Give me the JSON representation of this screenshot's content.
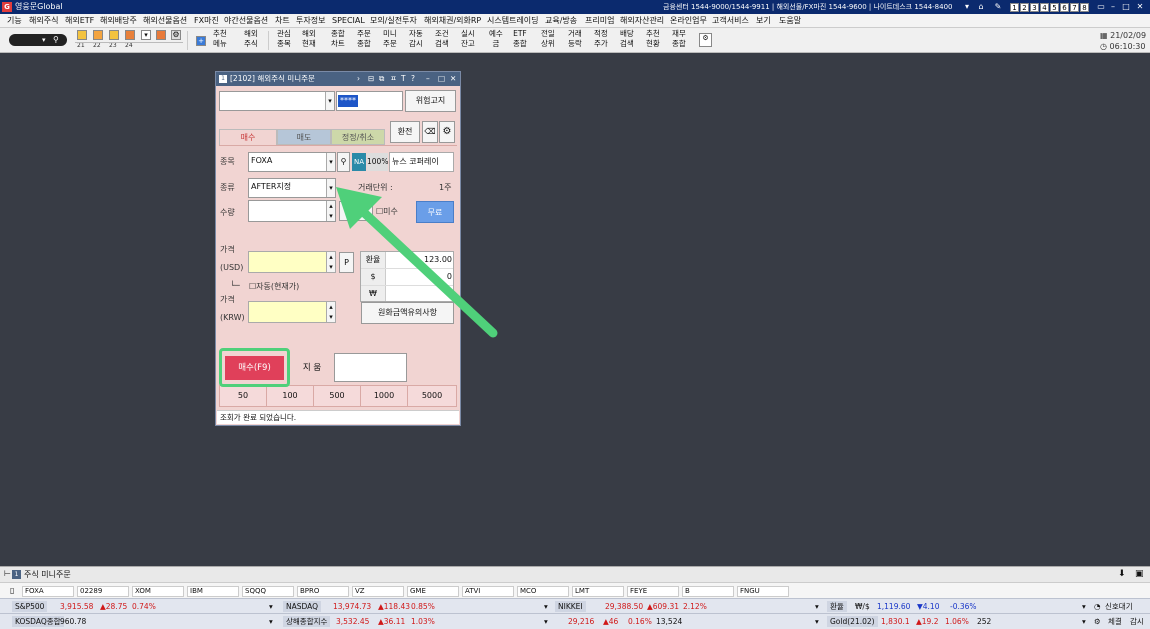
{
  "app": {
    "title": "영웅문Global",
    "info": "금융센터 1544-9000/1544-9911 | 해외선물/FX마진 1544-9600 | 나이트데스크 1544-8400",
    "screen_numbers": [
      "1",
      "2",
      "3",
      "4",
      "5",
      "6",
      "7",
      "8"
    ]
  },
  "menu": [
    "기능",
    "해외주식",
    "해외ETF",
    "해외배당주",
    "해외선물옵션",
    "FX마진",
    "야간선물옵션",
    "차트",
    "투자정보",
    "SPECIAL",
    "모의/실전투자",
    "해외채권/외화RP",
    "시스템트레이딩",
    "교육/방송",
    "프리미엄",
    "해외자산관리",
    "온라인업무",
    "고객서비스",
    "보기",
    "도움말"
  ],
  "toolbar": {
    "group_labels": [
      "21",
      "22",
      "23",
      "24"
    ],
    "buttons": [
      {
        "l1": "추천",
        "l2": "메뉴"
      },
      {
        "l1": "해외",
        "l2": "주식"
      },
      {
        "l1": "관심",
        "l2": "종목"
      },
      {
        "l1": "해외",
        "l2": "현재"
      },
      {
        "l1": "종합",
        "l2": "차트"
      },
      {
        "l1": "주문",
        "l2": "종합"
      },
      {
        "l1": "미니",
        "l2": "주문"
      },
      {
        "l1": "자동",
        "l2": "감시"
      },
      {
        "l1": "조건",
        "l2": "검색"
      },
      {
        "l1": "실시",
        "l2": "잔고"
      },
      {
        "l1": "예수",
        "l2": "금"
      },
      {
        "l1": "ETF",
        "l2": "종합"
      },
      {
        "l1": "전일",
        "l2": "상위"
      },
      {
        "l1": "거래",
        "l2": "등락"
      },
      {
        "l1": "적정",
        "l2": "주가"
      },
      {
        "l1": "배당",
        "l2": "검색"
      },
      {
        "l1": "추천",
        "l2": "현황"
      },
      {
        "l1": "재무",
        "l2": "종합"
      }
    ],
    "date": "21/02/09",
    "time": "06:10:30"
  },
  "dialog": {
    "title": "[2102] 해외주식 미니주문",
    "account_value": "",
    "password_mask": "****",
    "risk_button": "위험고지",
    "tabs": {
      "buy": "매수",
      "sell": "매도",
      "modify": "정정/취소"
    },
    "exchange_button": "환전",
    "labels": {
      "symbol": "종목",
      "type": "종류",
      "qty": "수량",
      "price": "가격",
      "usd": "(USD)",
      "krw": "(KRW)",
      "trade_unit": "거래단위 :",
      "trade_unit_value": "1주",
      "auto": "자동(현재가)",
      "misu": "미수"
    },
    "symbol": "FOXA",
    "na_badge": "NA",
    "pct_badge": "100%",
    "news_text": "뉴스 코퍼레이",
    "order_type": "AFTER지정",
    "free_button": "무료",
    "p_button": "P",
    "fx": {
      "rate_label": "환율",
      "rate_value": "123.00",
      "usd_label": "$",
      "usd_value": "0",
      "krw_label": "₩",
      "krw_value": ""
    },
    "won_notice_button": "원화금액유의사항",
    "buy_button": "매수(F9)",
    "clear_button": "지 움",
    "quick_qty": [
      "50",
      "100",
      "500",
      "1000",
      "5000"
    ],
    "status": "조회가 완료 되었습니다."
  },
  "bottom": {
    "tab": "주식 미니주문",
    "symbols": [
      "FOXA",
      "02289",
      "XOM",
      "IBM",
      "SQQQ",
      "BPRO",
      "VZ",
      "GME",
      "ATVI",
      "MCO",
      "LMT",
      "FEYE",
      "B",
      "FNGU"
    ],
    "row1": [
      {
        "name": "S&P500",
        "value": "3,915.58",
        "chg": "▲28.75",
        "pct": "0.74%"
      },
      {
        "name": "NASDAQ",
        "value": "13,974.73",
        "chg": "▲118.43",
        "pct": "0.85%"
      },
      {
        "name": "NIKKEI",
        "value": "29,388.50",
        "chg": "▲609.31",
        "pct": "2.12%"
      },
      {
        "name": "환율",
        "value": "1,119.60",
        "chg": "▼4.10",
        "pct": "-0.36%",
        "unit": "₩/$"
      }
    ],
    "row2": [
      {
        "name": "KOSDAQ종합",
        "value": "960.78"
      },
      {
        "name": "상해종합지수",
        "value": "3,532.45",
        "chg": "▲36.11",
        "pct": "1.03%"
      },
      {
        "name": "",
        "value": "29,216",
        "chg": "▲46",
        "pct": "0.16%",
        "vol": "13,524"
      },
      {
        "name": "Gold(21.02)",
        "value": "1,830.1",
        "chg": "▲19.2",
        "pct": "1.06%",
        "vol": "252"
      }
    ],
    "right1": "신호대기",
    "right2a": "체결",
    "right2b": "감시"
  },
  "colors": {
    "titlebar": "#0b2a6e",
    "buy_button": "#e0405a",
    "highlight": "#4fd07a",
    "up": "#d01818",
    "down": "#1836c8"
  }
}
